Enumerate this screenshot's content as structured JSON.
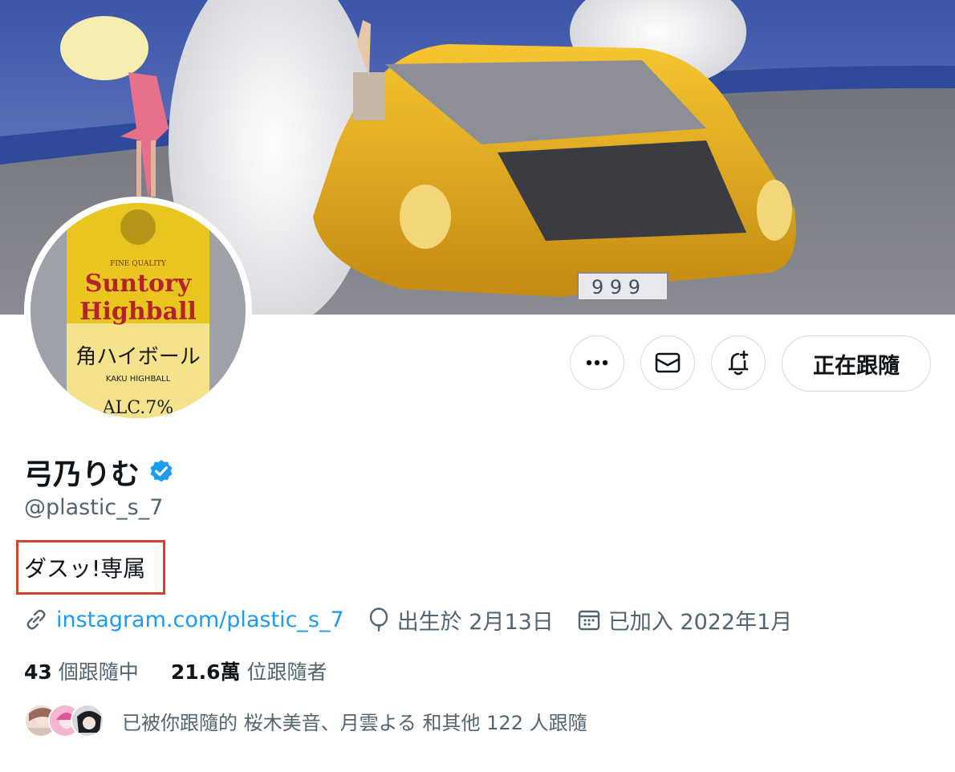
{
  "profile": {
    "display_name": "弓乃りむ",
    "handle": "@plastic_s_7",
    "bio": "ダスッ!専属",
    "verified": true,
    "accent_color": "#1d9bf0"
  },
  "actions": {
    "more_icon": "ellipsis-icon",
    "message_icon": "envelope-icon",
    "notify_icon": "bell-plus-icon",
    "follow_label": "正在跟隨"
  },
  "meta": {
    "link_text": "instagram.com/plastic_s_7",
    "birthday": "出生於 2月13日",
    "joined": "已加入 2022年1月"
  },
  "stats": {
    "following_count": "43",
    "following_label": "個跟隨中",
    "followers_count": "21.6萬",
    "followers_label": "位跟隨者"
  },
  "followed_by": {
    "text": "已被你跟隨的 桜木美音、月雲よる 和其他 122 人跟隨"
  },
  "avatar_art": {
    "line1": "FINE QUALITY",
    "brand1": "Suntory",
    "brand2": "Highball",
    "jp": "角ハイボール",
    "sub": "KAKU HIGHBALL",
    "alc": "ALC.7%"
  }
}
